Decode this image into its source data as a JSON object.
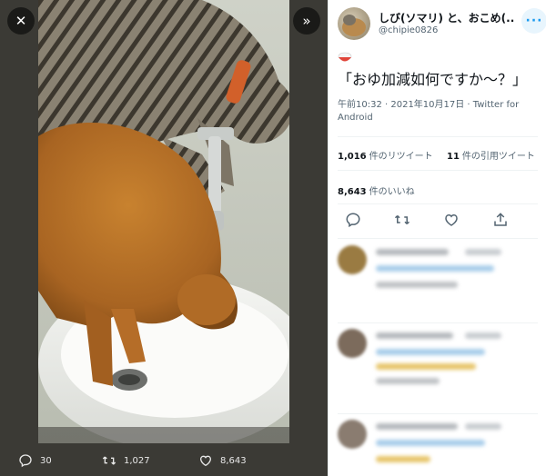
{
  "viewer": {
    "close_icon": "close-icon",
    "collapse_icon": "collapse-icon",
    "actions": {
      "reply_count": "30",
      "retweet_count": "1,027",
      "like_count": "8,643"
    }
  },
  "tweet": {
    "author_name": "しび(ソマリ) と、おこめ(...",
    "author_handle": "@chipie0826",
    "more_icon": "more-icon",
    "text": "「おゆ加減如何ですか〜？」",
    "emoji": "rice-bowl-emoji",
    "timestamp": "午前10:32 · 2021年10月17日 · Twitter for Android",
    "retweets_value": "1,016",
    "retweets_label": "件のリツイート",
    "quotes_value": "11",
    "quotes_label": "件の引用ツイート",
    "likes_value": "8,643",
    "likes_label": "件のいいね"
  },
  "colors": {
    "accent": "#1d9bf0",
    "viewer_bg": "#3b3a35"
  }
}
